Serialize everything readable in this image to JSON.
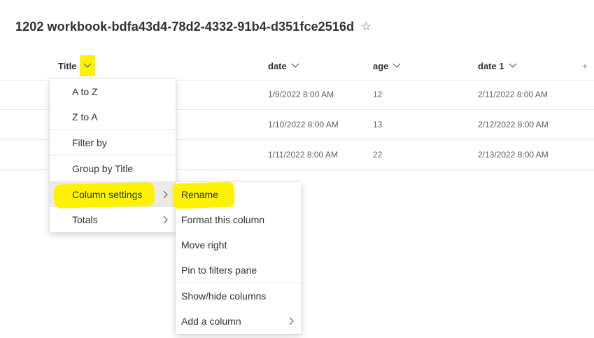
{
  "page": {
    "title": "1202 workbook-bdfa43d4-78d2-4332-91b4-d351fce2516d",
    "favorite_icon": "star-icon",
    "highlight_color": "#fff200"
  },
  "columns": {
    "title": "Title",
    "date": "date",
    "age": "age",
    "date1": "date 1",
    "add_column": "+"
  },
  "rows": [
    {
      "date": "1/9/2022 8:00 AM",
      "age": "12",
      "date1": "2/11/2022 8:00 AM"
    },
    {
      "date": "1/10/2022 8:00 AM",
      "age": "13",
      "date1": "2/12/2022 8:00 AM"
    },
    {
      "date": "1/11/2022 8:00 AM",
      "age": "22",
      "date1": "2/13/2022 8:00 AM"
    }
  ],
  "column_menu": {
    "a_to_z": "A to Z",
    "z_to_a": "Z to A",
    "filter_by": "Filter by",
    "group_by": "Group by Title",
    "column_settings": "Column settings",
    "totals": "Totals"
  },
  "settings_submenu": {
    "rename": "Rename",
    "format_column": "Format this column",
    "move_right": "Move right",
    "pin_filters": "Pin to filters pane",
    "show_hide": "Show/hide columns",
    "add_column": "Add a column"
  }
}
